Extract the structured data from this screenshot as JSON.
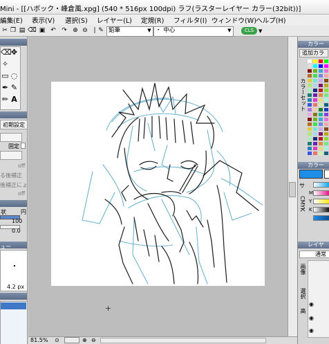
{
  "window": {
    "title": "Mini - [[ハボック・峰倉風.xpg] (540 * 516px 100dpi)   ラフ(ラスターレイヤー カラー(32bit))]"
  },
  "menu": [
    "編集(E)",
    "表示(V)",
    "選択(S)",
    "レイヤー(L)",
    "定規(R)",
    "フィルタ(I)",
    "ウィンドウ(W)",
    "ヘルプ(H)"
  ],
  "toolbar": {
    "brush_combo": "鉛筆",
    "position_combo": "・  中心",
    "badge": "CLS"
  },
  "left_panel": {
    "reset_label": "初期設定",
    "fixed_label": "固定",
    "off1": "off",
    "option1": "る後補正",
    "option2": "後補正にょ",
    "off2": "off",
    "shape_label": "状",
    "percent_label": "円",
    "value1": "100",
    "value2": "0.0",
    "preview_title": "ュー",
    "brush_size": "4.2 px"
  },
  "right_panel": {
    "color_panel_title": "カラー",
    "add_color_label": "追加カラ",
    "color_set_label": "カラーセット",
    "color_panel2_title": "カラー",
    "slider_label": "CMYK",
    "slider_marks": [
      "サ",
      "M",
      "Y",
      "K"
    ],
    "layer_panel_title": "レイヤ",
    "blend_mode": "通常",
    "layer_labels": [
      "画像",
      "選択",
      "高"
    ]
  },
  "status": {
    "zoom": "81.5%"
  },
  "colors": {
    "sketch_blue": "#6fb3cf",
    "sketch_dark": "#1a1a1a",
    "main_color": "#1f8ee8",
    "canvas_bg": "#bdbdbd"
  }
}
